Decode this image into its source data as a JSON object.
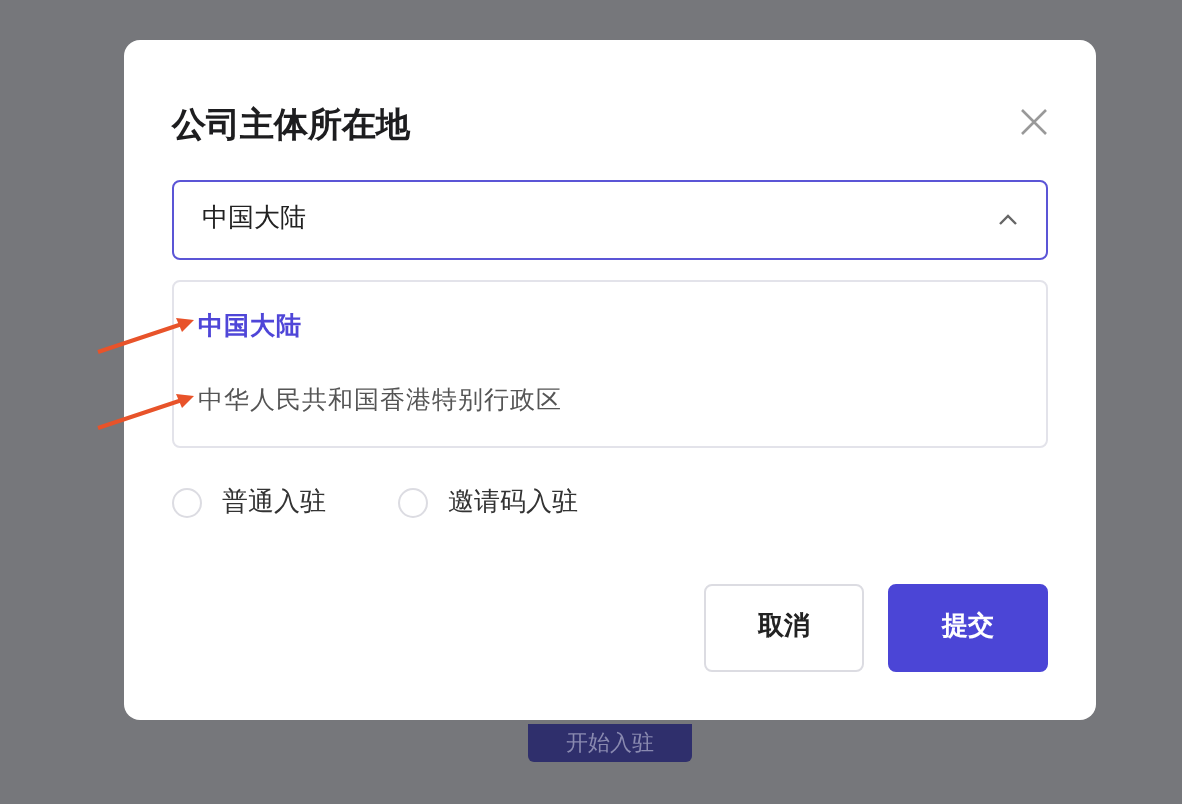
{
  "dialog": {
    "title": "公司主体所在地",
    "select": {
      "value": "中国大陆",
      "expanded": true
    },
    "options": [
      {
        "label": "中国大陆",
        "selected": true
      },
      {
        "label": "中华人民共和国香港特别行政区",
        "selected": false
      }
    ],
    "radios": [
      {
        "label": "普通入驻",
        "checked": false
      },
      {
        "label": "邀请码入驻",
        "checked": false
      }
    ],
    "buttons": [
      {
        "label": "取消",
        "kind": "secondary"
      },
      {
        "label": "提交",
        "kind": "primary"
      }
    ]
  },
  "background_button": {
    "label": "开始入驻"
  }
}
